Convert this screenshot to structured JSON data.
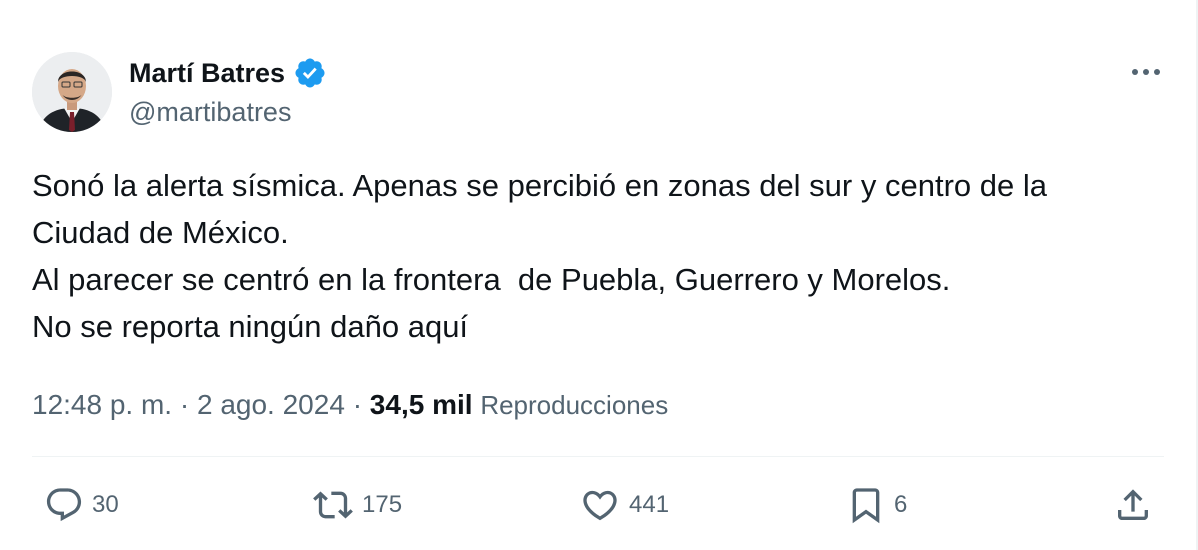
{
  "author": {
    "display_name": "Martí Batres",
    "handle": "@martibatres",
    "verified": true
  },
  "tweet": {
    "lines": [
      "Sonó la alerta sísmica. Apenas se percibió en zonas del sur y centro de la",
      "Ciudad de México.",
      "Al parecer se centró en la frontera  de Puebla, Guerrero y Morelos.",
      "No se reporta ningún daño aquí"
    ]
  },
  "meta": {
    "time": "12:48 p. m.",
    "separator": "·",
    "date": "2 ago. 2024",
    "views_count": "34,5 mil",
    "views_label": "Reproducciones"
  },
  "actions": {
    "replies": "30",
    "reposts": "175",
    "likes": "441",
    "bookmarks": "6"
  },
  "icons": {
    "verified": "verified-badge-icon",
    "more": "more-options-icon",
    "reply": "reply-bubble-icon",
    "repost": "repost-icon",
    "like": "heart-icon",
    "bookmark": "bookmark-icon",
    "share": "share-icon"
  },
  "colors": {
    "text": "#0f1419",
    "secondary": "#536471",
    "verified": "#1d9bf0",
    "divider": "#eff3f4"
  }
}
